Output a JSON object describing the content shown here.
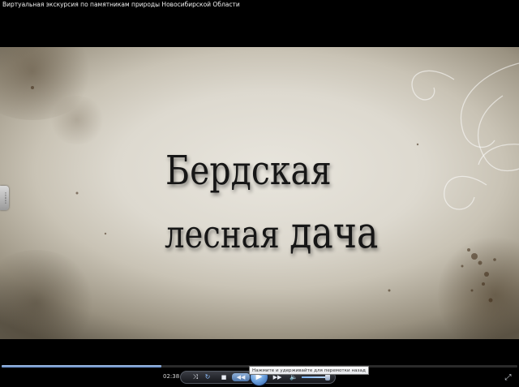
{
  "window": {
    "title": "Виртуальная экскурсия по памятникам природы Новосибирской Области"
  },
  "video": {
    "slide_line1": "Бердская",
    "slide_line2_word1": "лесная",
    "slide_line2_word2": "дача"
  },
  "player": {
    "elapsed_time": "02:38",
    "seek_progress_percent": 31,
    "volume_percent": 85,
    "tooltip": "Нажмите и удерживайте для перемотки назад",
    "icons": {
      "shuffle": "shuffle-icon",
      "repeat": "repeat-icon",
      "stop": "stop-icon",
      "rewind": "rewind-icon",
      "play": "play-icon",
      "fast_forward": "fast-forward-icon",
      "volume": "speaker-icon",
      "fullscreen": "fullscreen-icon"
    }
  },
  "colors": {
    "accent": "#5d85c2",
    "play_button": "#2a5aa6"
  }
}
